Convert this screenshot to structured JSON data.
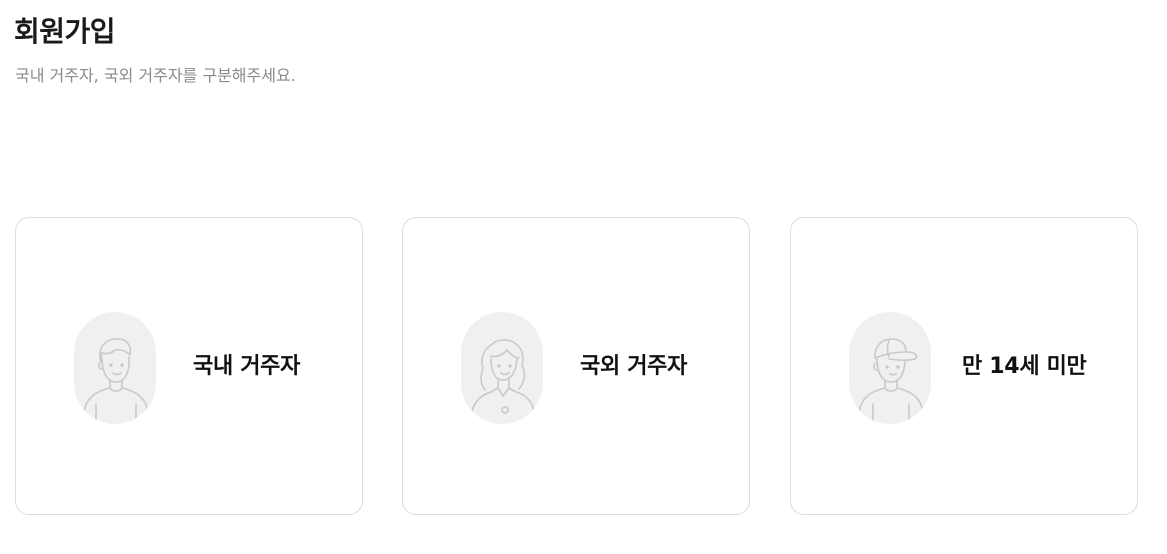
{
  "header": {
    "title": "회원가입",
    "subtitle": "국내 거주자, 국외 거주자를 구분해주세요."
  },
  "options": [
    {
      "label": "국내 거주자",
      "icon": "domestic-resident-avatar-icon"
    },
    {
      "label": "국외 거주자",
      "icon": "overseas-resident-avatar-icon"
    },
    {
      "label": "만 14세 미만",
      "icon": "under-14-avatar-icon"
    }
  ],
  "colors": {
    "card_border": "#dcdcdc",
    "avatar_bg": "#f0f0f0",
    "subtitle": "#8a8a8a",
    "title": "#1a1a1a"
  }
}
